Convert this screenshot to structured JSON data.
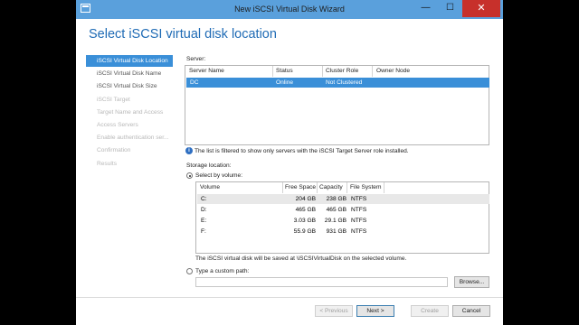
{
  "window": {
    "title": "New iSCSI Virtual Disk Wizard",
    "min": "—",
    "max": "☐",
    "close": "✕"
  },
  "heading": "Select iSCSI virtual disk location",
  "nav": [
    {
      "label": "iSCSI Virtual Disk Location",
      "state": "selected"
    },
    {
      "label": "iSCSI Virtual Disk Name",
      "state": "normal"
    },
    {
      "label": "iSCSI Virtual Disk Size",
      "state": "normal"
    },
    {
      "label": "iSCSI Target",
      "state": "disabled"
    },
    {
      "label": "Target Name and Access",
      "state": "disabled"
    },
    {
      "label": "Access Servers",
      "state": "disabled"
    },
    {
      "label": "Enable authentication ser...",
      "state": "disabled"
    },
    {
      "label": "Confirmation",
      "state": "disabled"
    },
    {
      "label": "Results",
      "state": "disabled"
    }
  ],
  "server": {
    "label": "Server:",
    "columns": [
      "Server Name",
      "Status",
      "Cluster Role",
      "Owner Node"
    ],
    "rows": [
      {
        "name": "DC",
        "status": "Online",
        "cluster_role": "Not Clustered",
        "owner_node": ""
      }
    ]
  },
  "info_text": "The list is filtered to show only servers with the iSCSI Target Server role installed.",
  "storage": {
    "label": "Storage location:",
    "select_by_volume": "Select by volume:",
    "columns": [
      "Volume",
      "Free Space",
      "Capacity",
      "File System"
    ],
    "rows": [
      {
        "volume": "C:",
        "free": "204 GB",
        "capacity": "238 GB",
        "fs": "NTFS"
      },
      {
        "volume": "D:",
        "free": "465 GB",
        "capacity": "465 GB",
        "fs": "NTFS"
      },
      {
        "volume": "E:",
        "free": "3.03 GB",
        "capacity": "29.1 GB",
        "fs": "NTFS"
      },
      {
        "volume": "F:",
        "free": "55.9 GB",
        "capacity": "931 GB",
        "fs": "NTFS"
      }
    ],
    "save_note": "The iSCSI virtual disk will be saved at \\iSCSIVirtualDisk on the selected volume.",
    "custom_path": "Type a custom path:",
    "custom_path_value": "",
    "browse": "Browse..."
  },
  "footer": {
    "previous": "< Previous",
    "next": "Next >",
    "create": "Create",
    "cancel": "Cancel"
  }
}
